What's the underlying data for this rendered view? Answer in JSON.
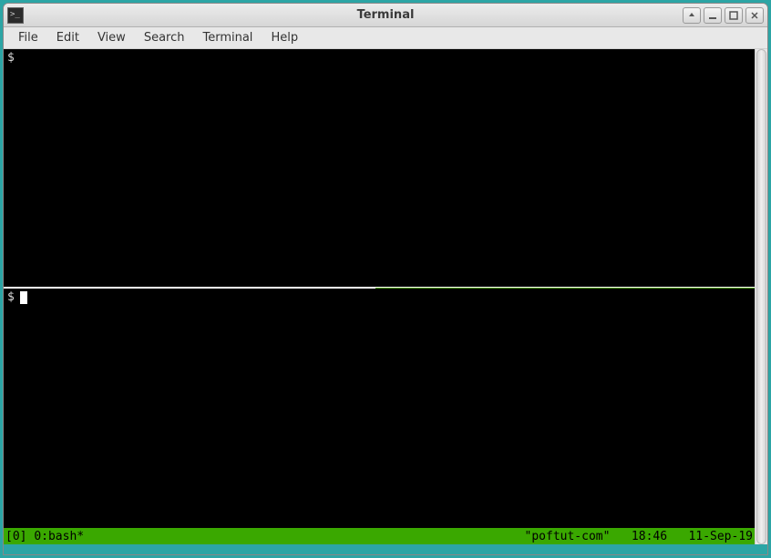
{
  "window": {
    "title": "Terminal",
    "icon_text": ">_"
  },
  "menubar": {
    "items": [
      "File",
      "Edit",
      "View",
      "Search",
      "Terminal",
      "Help"
    ]
  },
  "panes": {
    "top": {
      "prompt": "$"
    },
    "bottom": {
      "prompt": "$"
    }
  },
  "tmux": {
    "session": "[0]",
    "window": "0:bash*",
    "hostname": "\"poftut-com\"",
    "time": "18:46",
    "date": "11-Sep-19"
  }
}
